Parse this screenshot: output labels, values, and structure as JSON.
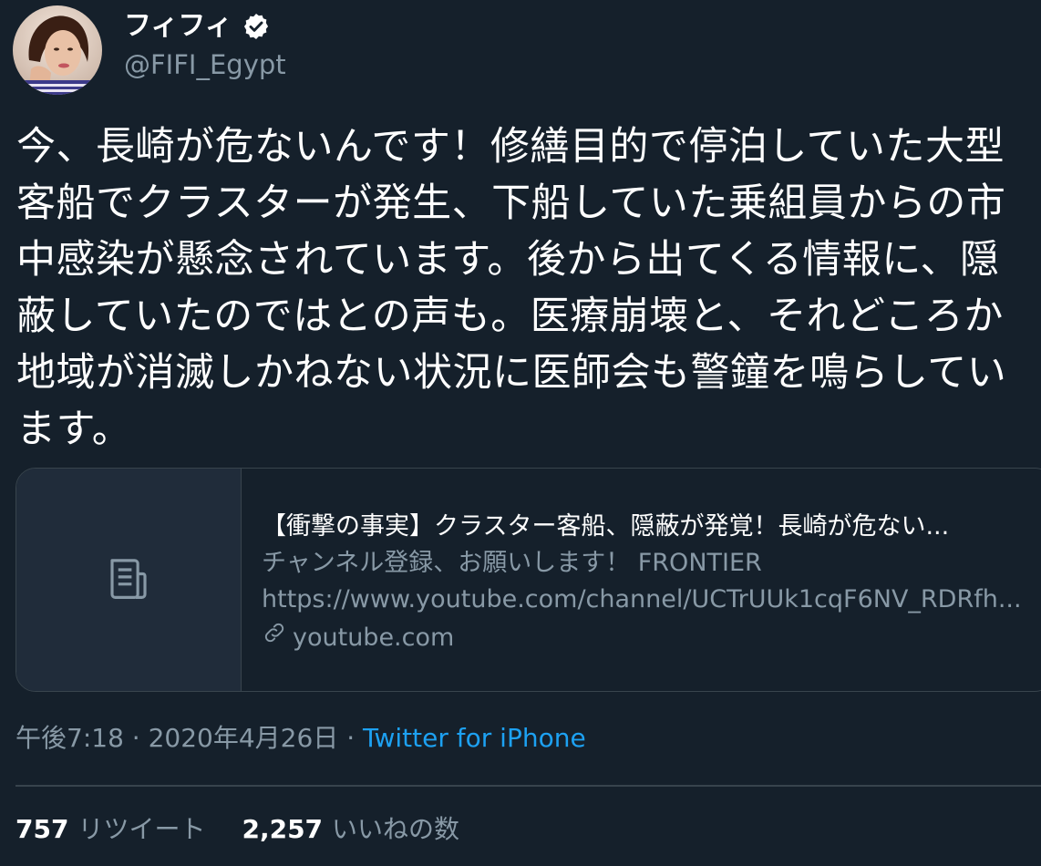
{
  "author": {
    "display_name": "フィフィ",
    "handle": "@FIFI_Egypt",
    "verified": true
  },
  "tweet": {
    "text": "今、長崎が危ないんです！修繕目的で停泊していた大型客船でクラスターが発生、下船していた乗組員からの市中感染が懸念されています。後から出てくる情報に、隠蔽していたのではとの声も。医療崩壊と、それどころか地域が消滅しかねない状況に医師会も警鐘を鳴らしています。"
  },
  "card": {
    "title": "【衝撃の事実】クラスター客船、隠蔽が発覚！長崎が危ない...",
    "description_line1": "チャンネル登録、お願いします！ FRONTIER",
    "description_line2": "https://www.youtube.com/channel/UCTrUUk1cqF6NV_RDRfh...",
    "domain": "youtube.com",
    "thumb_icon": "document-icon",
    "link_icon": "link-icon"
  },
  "meta": {
    "time": "午後7:18",
    "separator": "·",
    "date": "2020年4月26日",
    "source": "Twitter for iPhone"
  },
  "stats": {
    "retweets_count": "757",
    "retweets_label": "リツイート",
    "likes_count": "2,257",
    "likes_label": "いいねの数"
  },
  "colors": {
    "background": "#15202b",
    "accent": "#1da1f2",
    "secondary_text": "#8899a6",
    "border": "#38444d"
  }
}
